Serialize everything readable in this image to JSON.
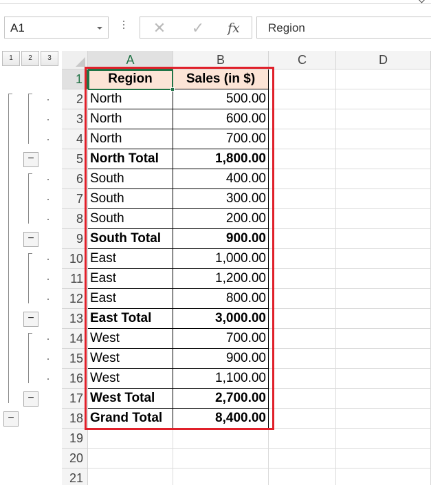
{
  "name_box": {
    "value": "A1"
  },
  "formula_bar": {
    "fx_label": "fx",
    "cancel_glyph": "✕",
    "enter_glyph": "✓",
    "content": "Region"
  },
  "outline": {
    "levels": [
      "1",
      "2",
      "3"
    ],
    "collapse_symbol": "−"
  },
  "columns": [
    "A",
    "B",
    "C",
    "D"
  ],
  "rows": [
    "1",
    "2",
    "3",
    "4",
    "5",
    "6",
    "7",
    "8",
    "9",
    "10",
    "11",
    "12",
    "13",
    "14",
    "15",
    "16",
    "17",
    "18",
    "19",
    "20",
    "21"
  ],
  "table": {
    "headers": [
      "Region",
      "Sales (in $)"
    ],
    "header_fill": "#fce4d6",
    "rows": [
      {
        "region": "North",
        "sales": "500.00",
        "bold": false
      },
      {
        "region": "North",
        "sales": "600.00",
        "bold": false
      },
      {
        "region": "North",
        "sales": "700.00",
        "bold": false
      },
      {
        "region": "North Total",
        "sales": "1,800.00",
        "bold": true
      },
      {
        "region": "South",
        "sales": "400.00",
        "bold": false
      },
      {
        "region": "South",
        "sales": "300.00",
        "bold": false
      },
      {
        "region": "South",
        "sales": "200.00",
        "bold": false
      },
      {
        "region": "South Total",
        "sales": "900.00",
        "bold": true
      },
      {
        "region": "East",
        "sales": "1,000.00",
        "bold": false
      },
      {
        "region": "East",
        "sales": "1,200.00",
        "bold": false
      },
      {
        "region": "East",
        "sales": "800.00",
        "bold": false
      },
      {
        "region": "East Total",
        "sales": "3,000.00",
        "bold": true
      },
      {
        "region": "West",
        "sales": "700.00",
        "bold": false
      },
      {
        "region": "West",
        "sales": "900.00",
        "bold": false
      },
      {
        "region": "West",
        "sales": "1,100.00",
        "bold": false
      },
      {
        "region": "West Total",
        "sales": "2,700.00",
        "bold": true
      },
      {
        "region": "Grand Total",
        "sales": "8,400.00",
        "bold": true
      }
    ]
  },
  "colors": {
    "accent": "#217346",
    "highlight_border": "#e0202a"
  }
}
